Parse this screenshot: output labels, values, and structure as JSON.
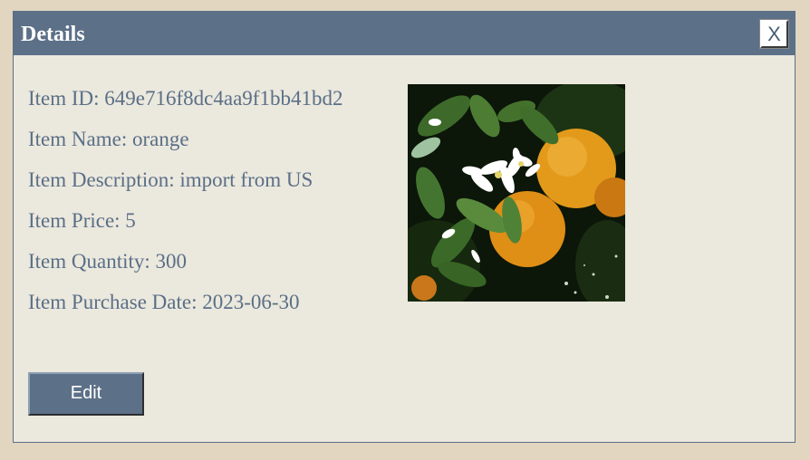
{
  "dialog": {
    "title": "Details",
    "close_label": "X"
  },
  "item": {
    "id_line": "Item ID: 649e716f8dc4aa9f1bb41bd2",
    "name_line": "Item Name: orange",
    "description_line": "Item Description: import from US",
    "price_line": "Item Price: 5",
    "quantity_line": "Item Quantity: 300",
    "purchase_date_line": "Item Purchase Date: 2023-06-30"
  },
  "image": {
    "subject": "orange-tree-photo"
  },
  "actions": {
    "edit_label": "Edit"
  },
  "colors": {
    "page_background": "#e2d6c0",
    "dialog_background": "#ebe8dd",
    "titlebar": "#5c7088",
    "text": "#5a6f87"
  }
}
